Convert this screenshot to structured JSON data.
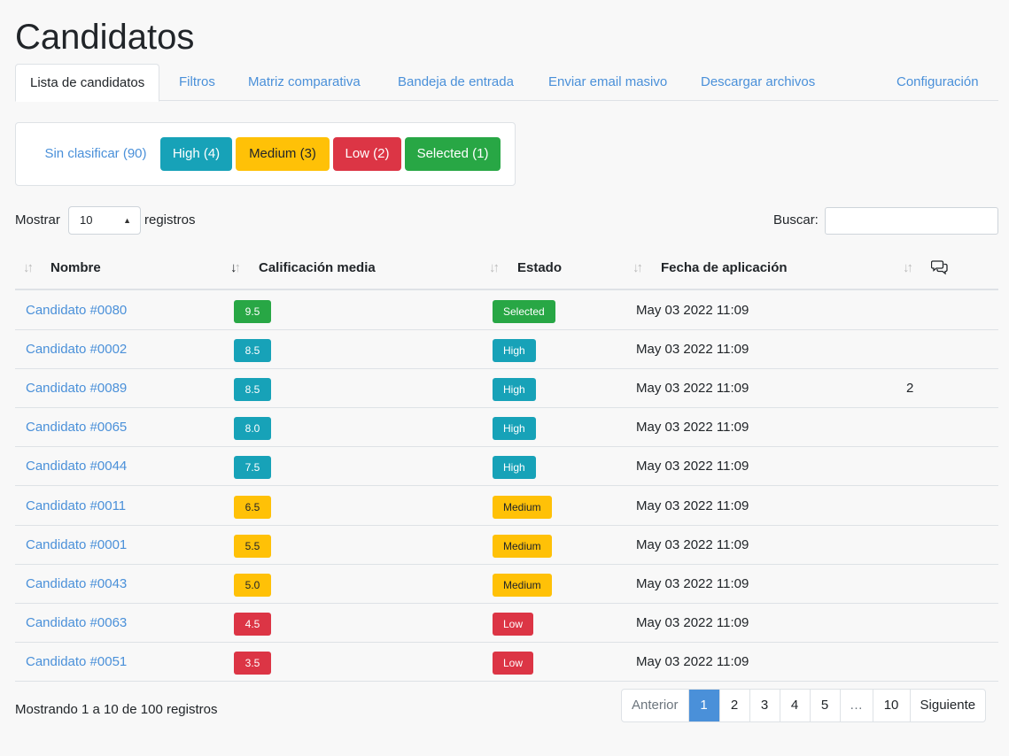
{
  "page_title": "Candidatos",
  "tabs": [
    {
      "label": "Lista de candidatos"
    },
    {
      "label": "Filtros"
    },
    {
      "label": "Matriz comparativa"
    },
    {
      "label": "Bandeja de entrada"
    },
    {
      "label": "Enviar email masivo"
    },
    {
      "label": "Descargar archivos"
    },
    {
      "label": "Configuración"
    }
  ],
  "filters": {
    "unclassified": "Sin clasificar (90)",
    "high": "High (4)",
    "medium": "Medium (3)",
    "low": "Low (2)",
    "selected": "Selected (1)"
  },
  "length_control": {
    "prefix": "Mostrar",
    "value": "10",
    "suffix": "registros"
  },
  "search": {
    "label": "Buscar:",
    "value": ""
  },
  "table": {
    "headers": {
      "name": "Nombre",
      "score": "Calificación media",
      "state": "Estado",
      "date": "Fecha de aplicación"
    },
    "rows": [
      {
        "name": "Candidato #0080",
        "score": "9.5",
        "state": "Selected",
        "date": "May 03 2022 11:09",
        "comments": ""
      },
      {
        "name": "Candidato #0002",
        "score": "8.5",
        "state": "High",
        "date": "May 03 2022 11:09",
        "comments": ""
      },
      {
        "name": "Candidato #0089",
        "score": "8.5",
        "state": "High",
        "date": "May 03 2022 11:09",
        "comments": "2"
      },
      {
        "name": "Candidato #0065",
        "score": "8.0",
        "state": "High",
        "date": "May 03 2022 11:09",
        "comments": ""
      },
      {
        "name": "Candidato #0044",
        "score": "7.5",
        "state": "High",
        "date": "May 03 2022 11:09",
        "comments": ""
      },
      {
        "name": "Candidato #0011",
        "score": "6.5",
        "state": "Medium",
        "date": "May 03 2022 11:09",
        "comments": ""
      },
      {
        "name": "Candidato #0001",
        "score": "5.5",
        "state": "Medium",
        "date": "May 03 2022 11:09",
        "comments": ""
      },
      {
        "name": "Candidato #0043",
        "score": "5.0",
        "state": "Medium",
        "date": "May 03 2022 11:09",
        "comments": ""
      },
      {
        "name": "Candidato #0063",
        "score": "4.5",
        "state": "Low",
        "date": "May 03 2022 11:09",
        "comments": ""
      },
      {
        "name": "Candidato #0051",
        "score": "3.5",
        "state": "Low",
        "date": "May 03 2022 11:09",
        "comments": ""
      }
    ]
  },
  "footer": {
    "info": "Mostrando 1 a 10 de 100 registros"
  },
  "pagination": {
    "previous": "Anterior",
    "pages": [
      "1",
      "2",
      "3",
      "4",
      "5",
      "…",
      "10"
    ],
    "next": "Siguiente"
  },
  "colors": {
    "selected": "#28a745",
    "high": "#17a2b8",
    "medium": "#ffc107",
    "low": "#dc3545",
    "link": "#4a90d9"
  },
  "icons": {
    "sort": "sort-icon",
    "sort_active": "sort-desc-icon",
    "comments": "comments-icon",
    "select_caret": "select-caret-icon"
  }
}
